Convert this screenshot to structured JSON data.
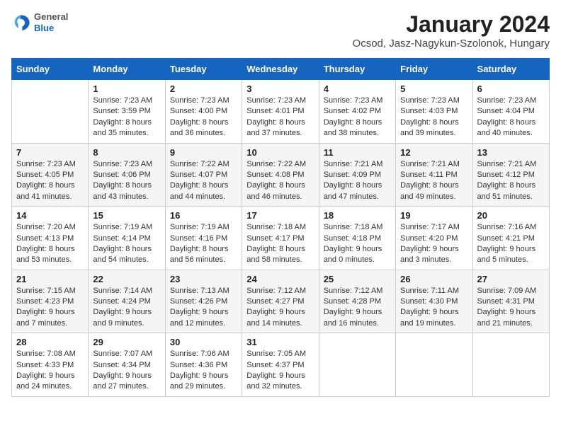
{
  "logo": {
    "general": "General",
    "blue": "Blue"
  },
  "title": "January 2024",
  "subtitle": "Ocsod, Jasz-Nagykun-Szolonok, Hungary",
  "days_header": [
    "Sunday",
    "Monday",
    "Tuesday",
    "Wednesday",
    "Thursday",
    "Friday",
    "Saturday"
  ],
  "weeks": [
    [
      {
        "num": "",
        "info": ""
      },
      {
        "num": "1",
        "info": "Sunrise: 7:23 AM\nSunset: 3:59 PM\nDaylight: 8 hours\nand 35 minutes."
      },
      {
        "num": "2",
        "info": "Sunrise: 7:23 AM\nSunset: 4:00 PM\nDaylight: 8 hours\nand 36 minutes."
      },
      {
        "num": "3",
        "info": "Sunrise: 7:23 AM\nSunset: 4:01 PM\nDaylight: 8 hours\nand 37 minutes."
      },
      {
        "num": "4",
        "info": "Sunrise: 7:23 AM\nSunset: 4:02 PM\nDaylight: 8 hours\nand 38 minutes."
      },
      {
        "num": "5",
        "info": "Sunrise: 7:23 AM\nSunset: 4:03 PM\nDaylight: 8 hours\nand 39 minutes."
      },
      {
        "num": "6",
        "info": "Sunrise: 7:23 AM\nSunset: 4:04 PM\nDaylight: 8 hours\nand 40 minutes."
      }
    ],
    [
      {
        "num": "7",
        "info": "Sunrise: 7:23 AM\nSunset: 4:05 PM\nDaylight: 8 hours\nand 41 minutes."
      },
      {
        "num": "8",
        "info": "Sunrise: 7:23 AM\nSunset: 4:06 PM\nDaylight: 8 hours\nand 43 minutes."
      },
      {
        "num": "9",
        "info": "Sunrise: 7:22 AM\nSunset: 4:07 PM\nDaylight: 8 hours\nand 44 minutes."
      },
      {
        "num": "10",
        "info": "Sunrise: 7:22 AM\nSunset: 4:08 PM\nDaylight: 8 hours\nand 46 minutes."
      },
      {
        "num": "11",
        "info": "Sunrise: 7:21 AM\nSunset: 4:09 PM\nDaylight: 8 hours\nand 47 minutes."
      },
      {
        "num": "12",
        "info": "Sunrise: 7:21 AM\nSunset: 4:11 PM\nDaylight: 8 hours\nand 49 minutes."
      },
      {
        "num": "13",
        "info": "Sunrise: 7:21 AM\nSunset: 4:12 PM\nDaylight: 8 hours\nand 51 minutes."
      }
    ],
    [
      {
        "num": "14",
        "info": "Sunrise: 7:20 AM\nSunset: 4:13 PM\nDaylight: 8 hours\nand 53 minutes."
      },
      {
        "num": "15",
        "info": "Sunrise: 7:19 AM\nSunset: 4:14 PM\nDaylight: 8 hours\nand 54 minutes."
      },
      {
        "num": "16",
        "info": "Sunrise: 7:19 AM\nSunset: 4:16 PM\nDaylight: 8 hours\nand 56 minutes."
      },
      {
        "num": "17",
        "info": "Sunrise: 7:18 AM\nSunset: 4:17 PM\nDaylight: 8 hours\nand 58 minutes."
      },
      {
        "num": "18",
        "info": "Sunrise: 7:18 AM\nSunset: 4:18 PM\nDaylight: 9 hours\nand 0 minutes."
      },
      {
        "num": "19",
        "info": "Sunrise: 7:17 AM\nSunset: 4:20 PM\nDaylight: 9 hours\nand 3 minutes."
      },
      {
        "num": "20",
        "info": "Sunrise: 7:16 AM\nSunset: 4:21 PM\nDaylight: 9 hours\nand 5 minutes."
      }
    ],
    [
      {
        "num": "21",
        "info": "Sunrise: 7:15 AM\nSunset: 4:23 PM\nDaylight: 9 hours\nand 7 minutes."
      },
      {
        "num": "22",
        "info": "Sunrise: 7:14 AM\nSunset: 4:24 PM\nDaylight: 9 hours\nand 9 minutes."
      },
      {
        "num": "23",
        "info": "Sunrise: 7:13 AM\nSunset: 4:26 PM\nDaylight: 9 hours\nand 12 minutes."
      },
      {
        "num": "24",
        "info": "Sunrise: 7:12 AM\nSunset: 4:27 PM\nDaylight: 9 hours\nand 14 minutes."
      },
      {
        "num": "25",
        "info": "Sunrise: 7:12 AM\nSunset: 4:28 PM\nDaylight: 9 hours\nand 16 minutes."
      },
      {
        "num": "26",
        "info": "Sunrise: 7:11 AM\nSunset: 4:30 PM\nDaylight: 9 hours\nand 19 minutes."
      },
      {
        "num": "27",
        "info": "Sunrise: 7:09 AM\nSunset: 4:31 PM\nDaylight: 9 hours\nand 21 minutes."
      }
    ],
    [
      {
        "num": "28",
        "info": "Sunrise: 7:08 AM\nSunset: 4:33 PM\nDaylight: 9 hours\nand 24 minutes."
      },
      {
        "num": "29",
        "info": "Sunrise: 7:07 AM\nSunset: 4:34 PM\nDaylight: 9 hours\nand 27 minutes."
      },
      {
        "num": "30",
        "info": "Sunrise: 7:06 AM\nSunset: 4:36 PM\nDaylight: 9 hours\nand 29 minutes."
      },
      {
        "num": "31",
        "info": "Sunrise: 7:05 AM\nSunset: 4:37 PM\nDaylight: 9 hours\nand 32 minutes."
      },
      {
        "num": "",
        "info": ""
      },
      {
        "num": "",
        "info": ""
      },
      {
        "num": "",
        "info": ""
      }
    ]
  ]
}
